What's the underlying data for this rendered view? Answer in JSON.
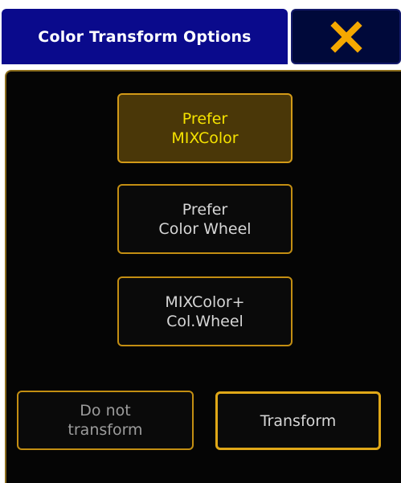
{
  "dialog": {
    "title": "Color Transform Options",
    "close_icon": "close-x-icon"
  },
  "options": [
    {
      "line1": "Prefer",
      "line2": "MIXColor",
      "selected": true
    },
    {
      "line1": "Prefer",
      "line2": "Color Wheel",
      "selected": false
    },
    {
      "line1": "MIXColor+",
      "line2": "Col.Wheel",
      "selected": false
    }
  ],
  "actions": {
    "do_not_transform": {
      "line1": "Do not",
      "line2": "transform"
    },
    "transform": {
      "label": "Transform"
    }
  },
  "colors": {
    "title_bg": "#0a0a8c",
    "close_bg": "#00093a",
    "close_icon": "#f5a800",
    "border_accent": "#c38e12",
    "selected_bg": "#4a3708",
    "selected_text": "#f5e200"
  }
}
